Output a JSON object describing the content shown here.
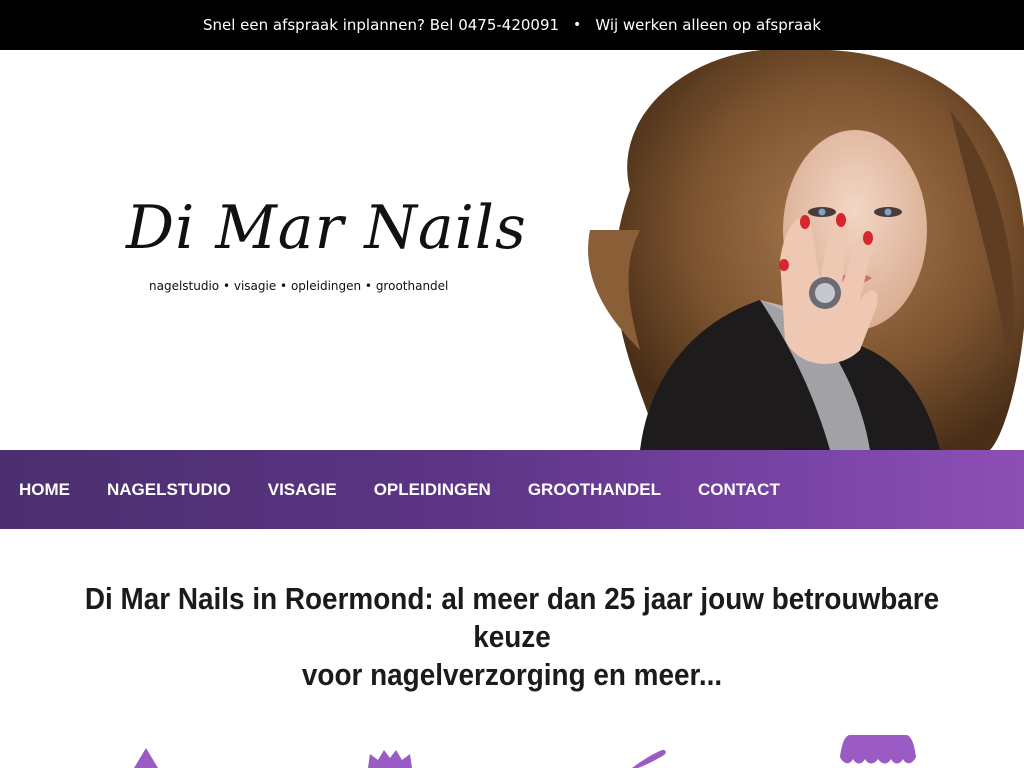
{
  "topbar": {
    "call_text": "Snel een afspraak inplannen? Bel 0475-420091",
    "separator": "•",
    "appointment_text": "Wij werken alleen op afspraak"
  },
  "hero": {
    "logo_title": "Di Mar Nails",
    "logo_subtitle": "nagelstudio • visagie • opleidingen • groothandel"
  },
  "nav": {
    "items": [
      {
        "label": "HOME"
      },
      {
        "label": "NAGELSTUDIO"
      },
      {
        "label": "VISAGIE"
      },
      {
        "label": "OPLEIDINGEN"
      },
      {
        "label": "GROOTHANDEL"
      },
      {
        "label": "CONTACT"
      }
    ]
  },
  "main": {
    "headline_line1": "Di Mar Nails in Roermond: al meer dan 25 jaar jouw betrouwbare keuze",
    "headline_line2": "voor nagelverzorging en meer..."
  },
  "colors": {
    "accent": "#8d4fb4",
    "nav_dark": "#4b2f6e",
    "icon": "#9a5cc4"
  },
  "icons": [
    "nail-polish-icon",
    "crown-icon",
    "brush-icon",
    "awning-icon"
  ]
}
